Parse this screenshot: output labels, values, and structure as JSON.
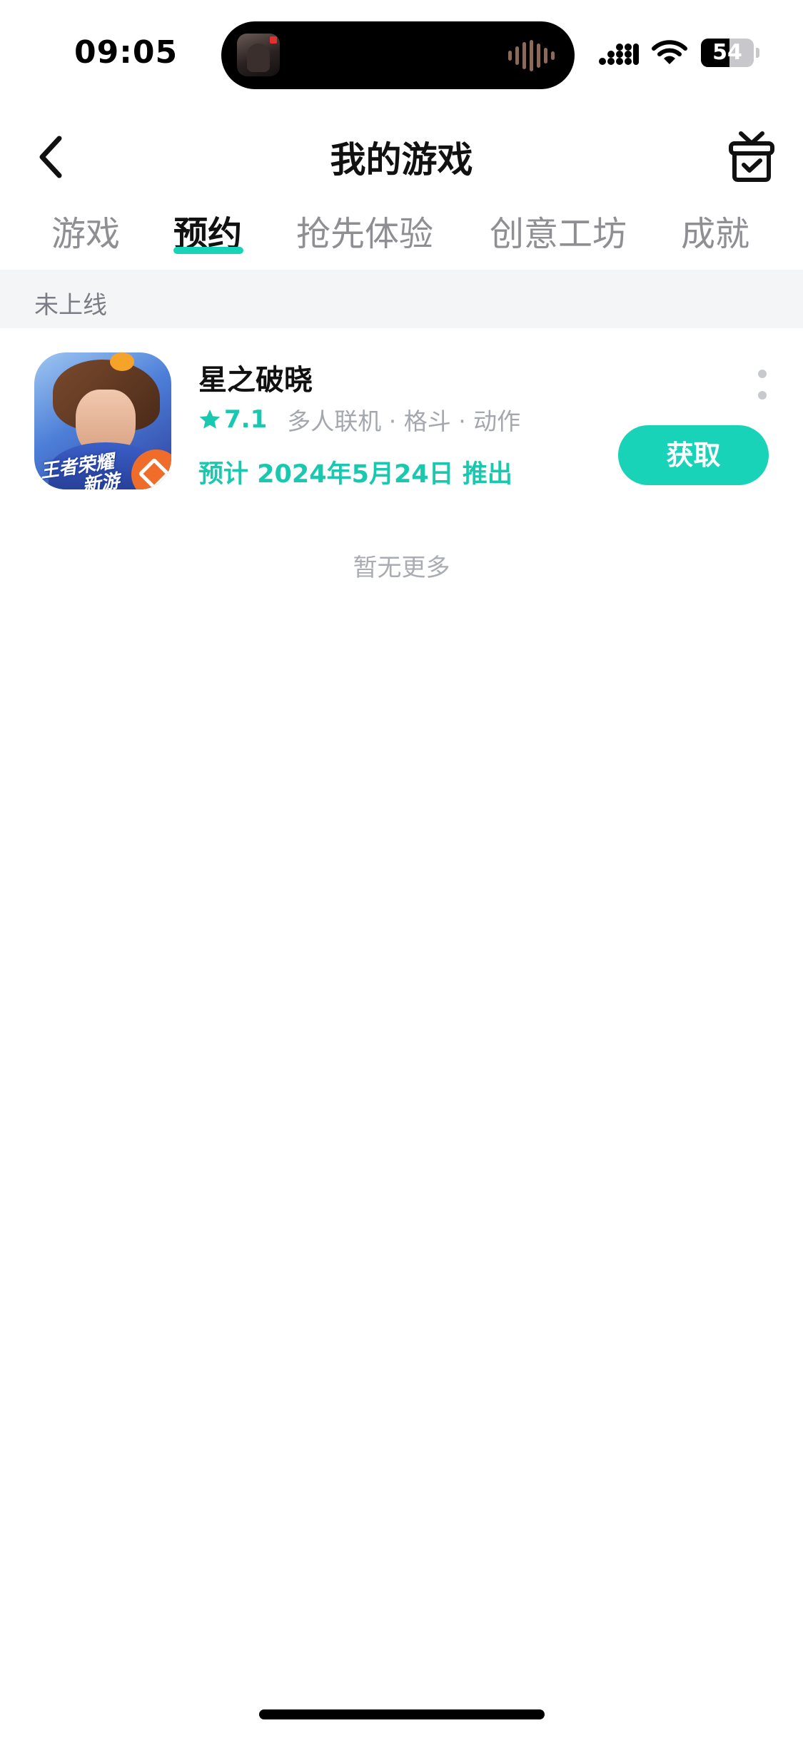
{
  "status_bar": {
    "time": "09:05",
    "battery_level": "54",
    "battery_fraction": 0.54
  },
  "nav": {
    "title": "我的游戏",
    "back_icon": "chevron-left-icon",
    "gift_icon": "gift-box-icon"
  },
  "tabs": [
    {
      "label": "游戏",
      "active": false
    },
    {
      "label": "预约",
      "active": true
    },
    {
      "label": "抢先体验",
      "active": false
    },
    {
      "label": "创意工坊",
      "active": false
    },
    {
      "label": "成就",
      "active": false
    }
  ],
  "section": {
    "title": "未上线"
  },
  "game": {
    "name": "星之破晓",
    "rating": "7.1",
    "tags": "多人联机 · 格斗 · 动作",
    "release": "预计 2024年5月24日 推出",
    "icon_badge_line1": "王者荣耀",
    "icon_badge_line2": "新游",
    "get_label": "获取"
  },
  "footer": {
    "no_more": "暂无更多"
  },
  "colors": {
    "accent": "#19d3b9",
    "accent_text": "#19c8ae",
    "section_bg": "#f4f5f7",
    "muted_text": "#8e8e93"
  }
}
